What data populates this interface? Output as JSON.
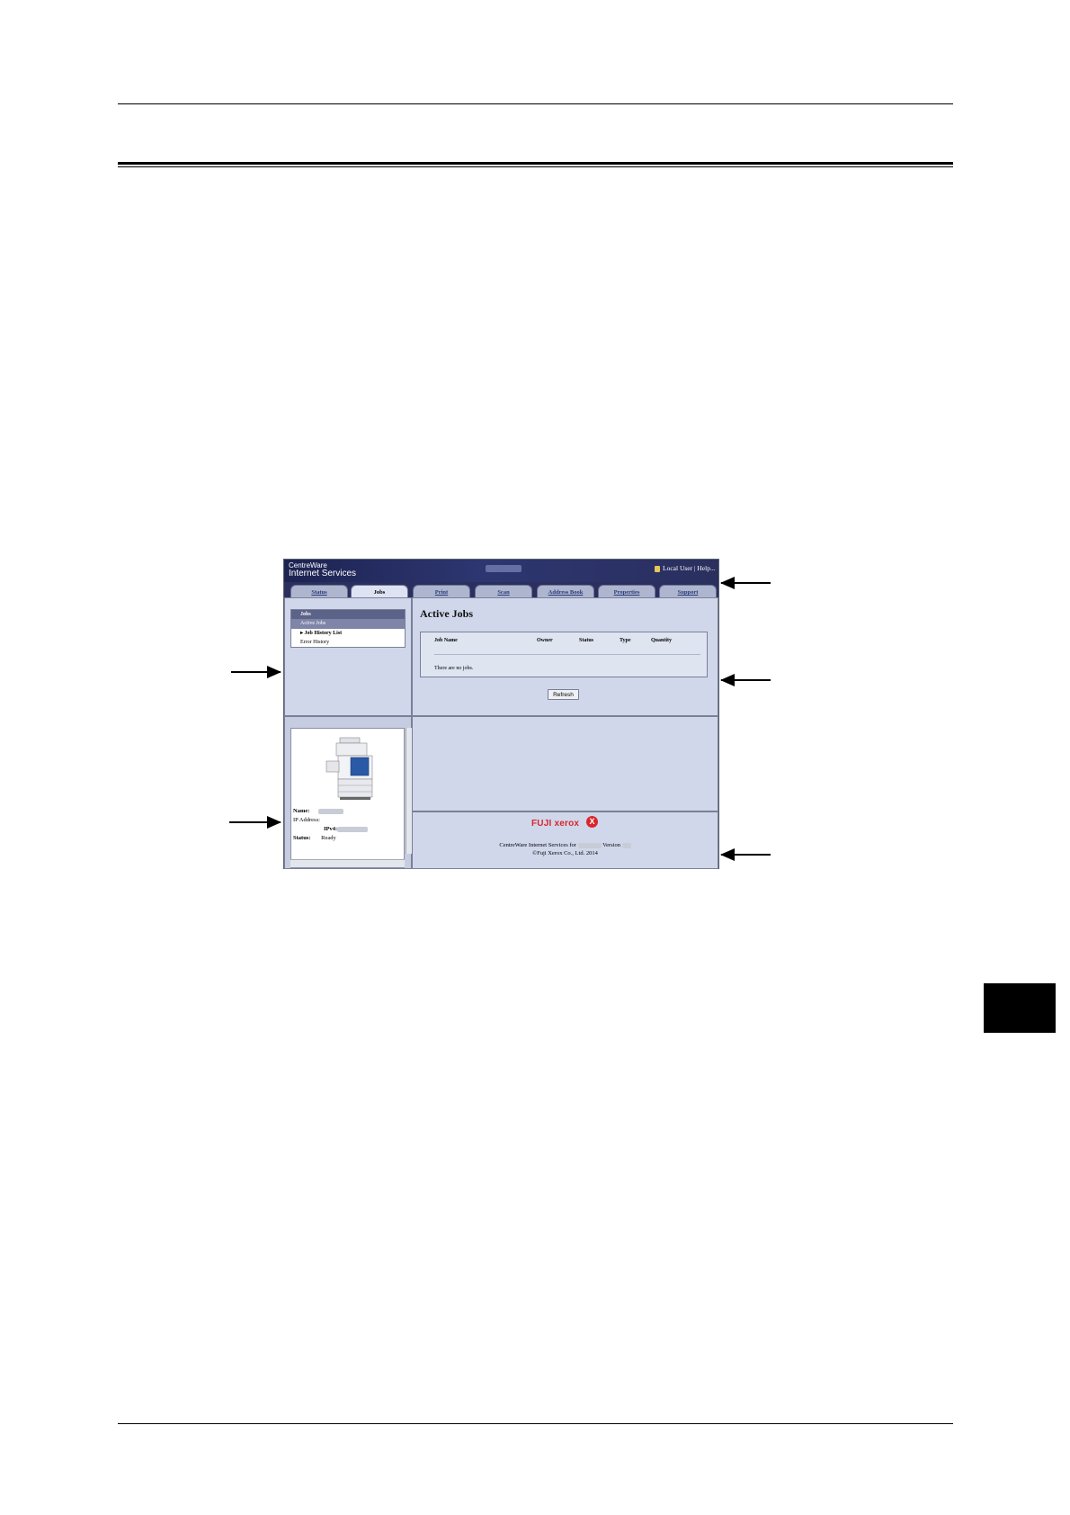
{
  "ui": {
    "brand_line1": "CentreWare",
    "brand_line2": "Internet Services",
    "user_help": "Local User | Help...",
    "tabs": [
      "Status",
      "Jobs",
      "Print",
      "Scan",
      "Address Book",
      "Properties",
      "Support"
    ],
    "active_tab": "Jobs",
    "nav": {
      "header": "Jobs",
      "items": [
        "Active Jobs",
        "Job History List",
        "Error History"
      ]
    },
    "main": {
      "title": "Active Jobs",
      "columns": [
        "Job Name",
        "Owner",
        "Status",
        "Type",
        "Quantity"
      ],
      "empty_text": "There are no jobs.",
      "refresh_label": "Refresh"
    },
    "device": {
      "name_label": "Name:",
      "ip_label": "IP Address:",
      "ipv4_label": "IPv4:",
      "status_label": "Status:",
      "status_value": "Ready"
    },
    "footer": {
      "logo": "FUJI xerox",
      "line1_prefix": "CentreWare Internet Services for",
      "line1_version": "Version",
      "line2": "©Fuji Xerox Co., Ltd. 2014"
    }
  },
  "colors": {
    "header_bg": "#1d2352",
    "panel_bg": "#d0d7ea",
    "logo_red": "#d9262c"
  }
}
